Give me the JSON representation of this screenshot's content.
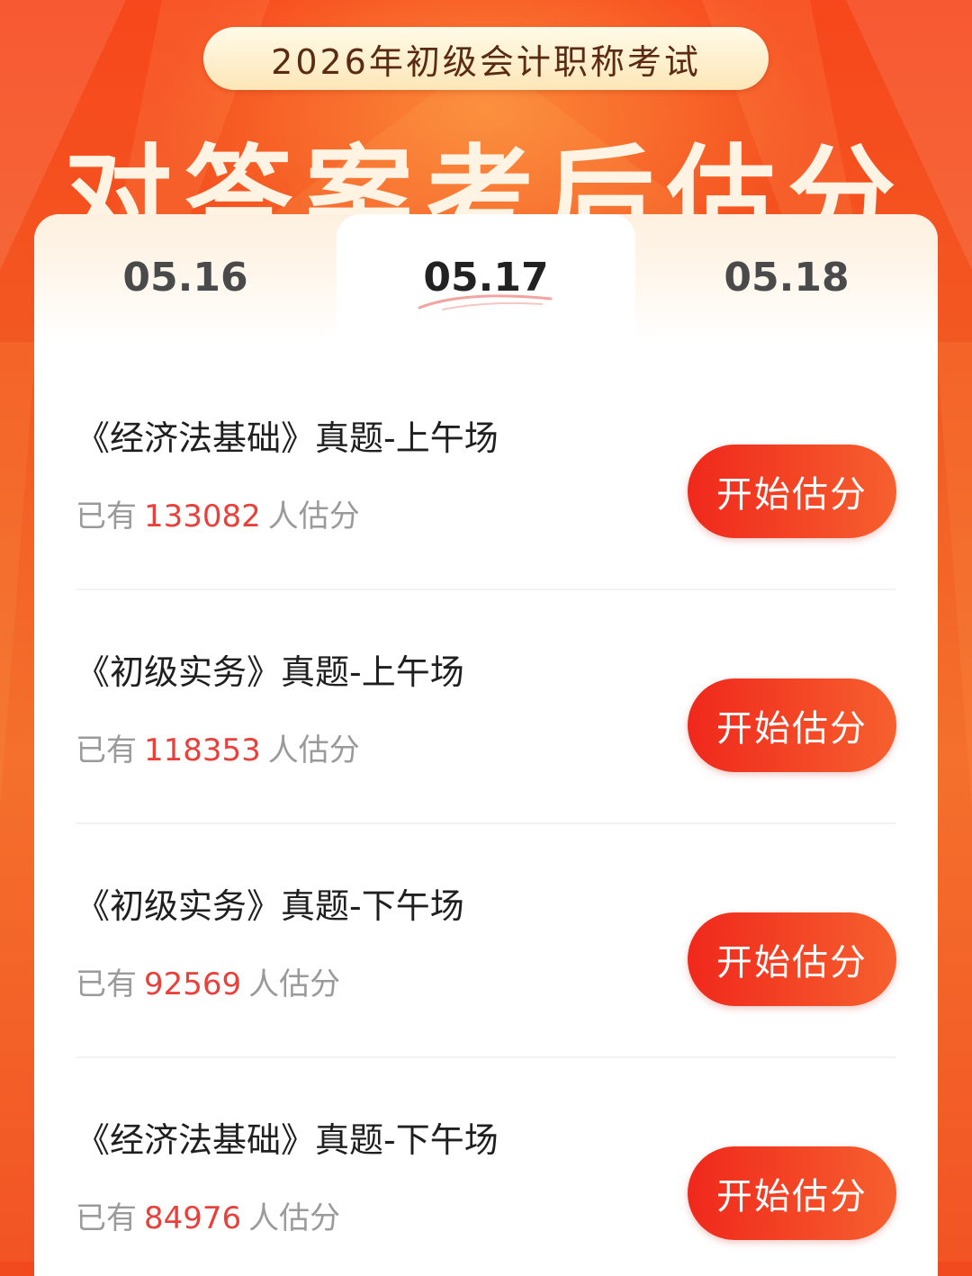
{
  "colors": {
    "accent": "#f0281c",
    "count": "#e8403a",
    "banner": "#f25a22"
  },
  "header": {
    "exam_title": "2026年初级会计职称考试",
    "big_title": "对答案考后估分"
  },
  "tabs": [
    {
      "label": "05.16",
      "selected": false
    },
    {
      "label": "05.17",
      "selected": true
    },
    {
      "label": "05.18",
      "selected": false
    }
  ],
  "items": [
    {
      "title": "《经济法基础》真题-上午场",
      "prefix": "已有",
      "count": "133082",
      "suffix": "人估分",
      "button": "开始估分"
    },
    {
      "title": "《初级实务》真题-上午场",
      "prefix": "已有",
      "count": "118353",
      "suffix": "人估分",
      "button": "开始估分"
    },
    {
      "title": "《初级实务》真题-下午场",
      "prefix": "已有",
      "count": "92569",
      "suffix": "人估分",
      "button": "开始估分"
    },
    {
      "title": "《经济法基础》真题-下午场",
      "prefix": "已有",
      "count": "84976",
      "suffix": "人估分",
      "button": "开始估分"
    }
  ]
}
